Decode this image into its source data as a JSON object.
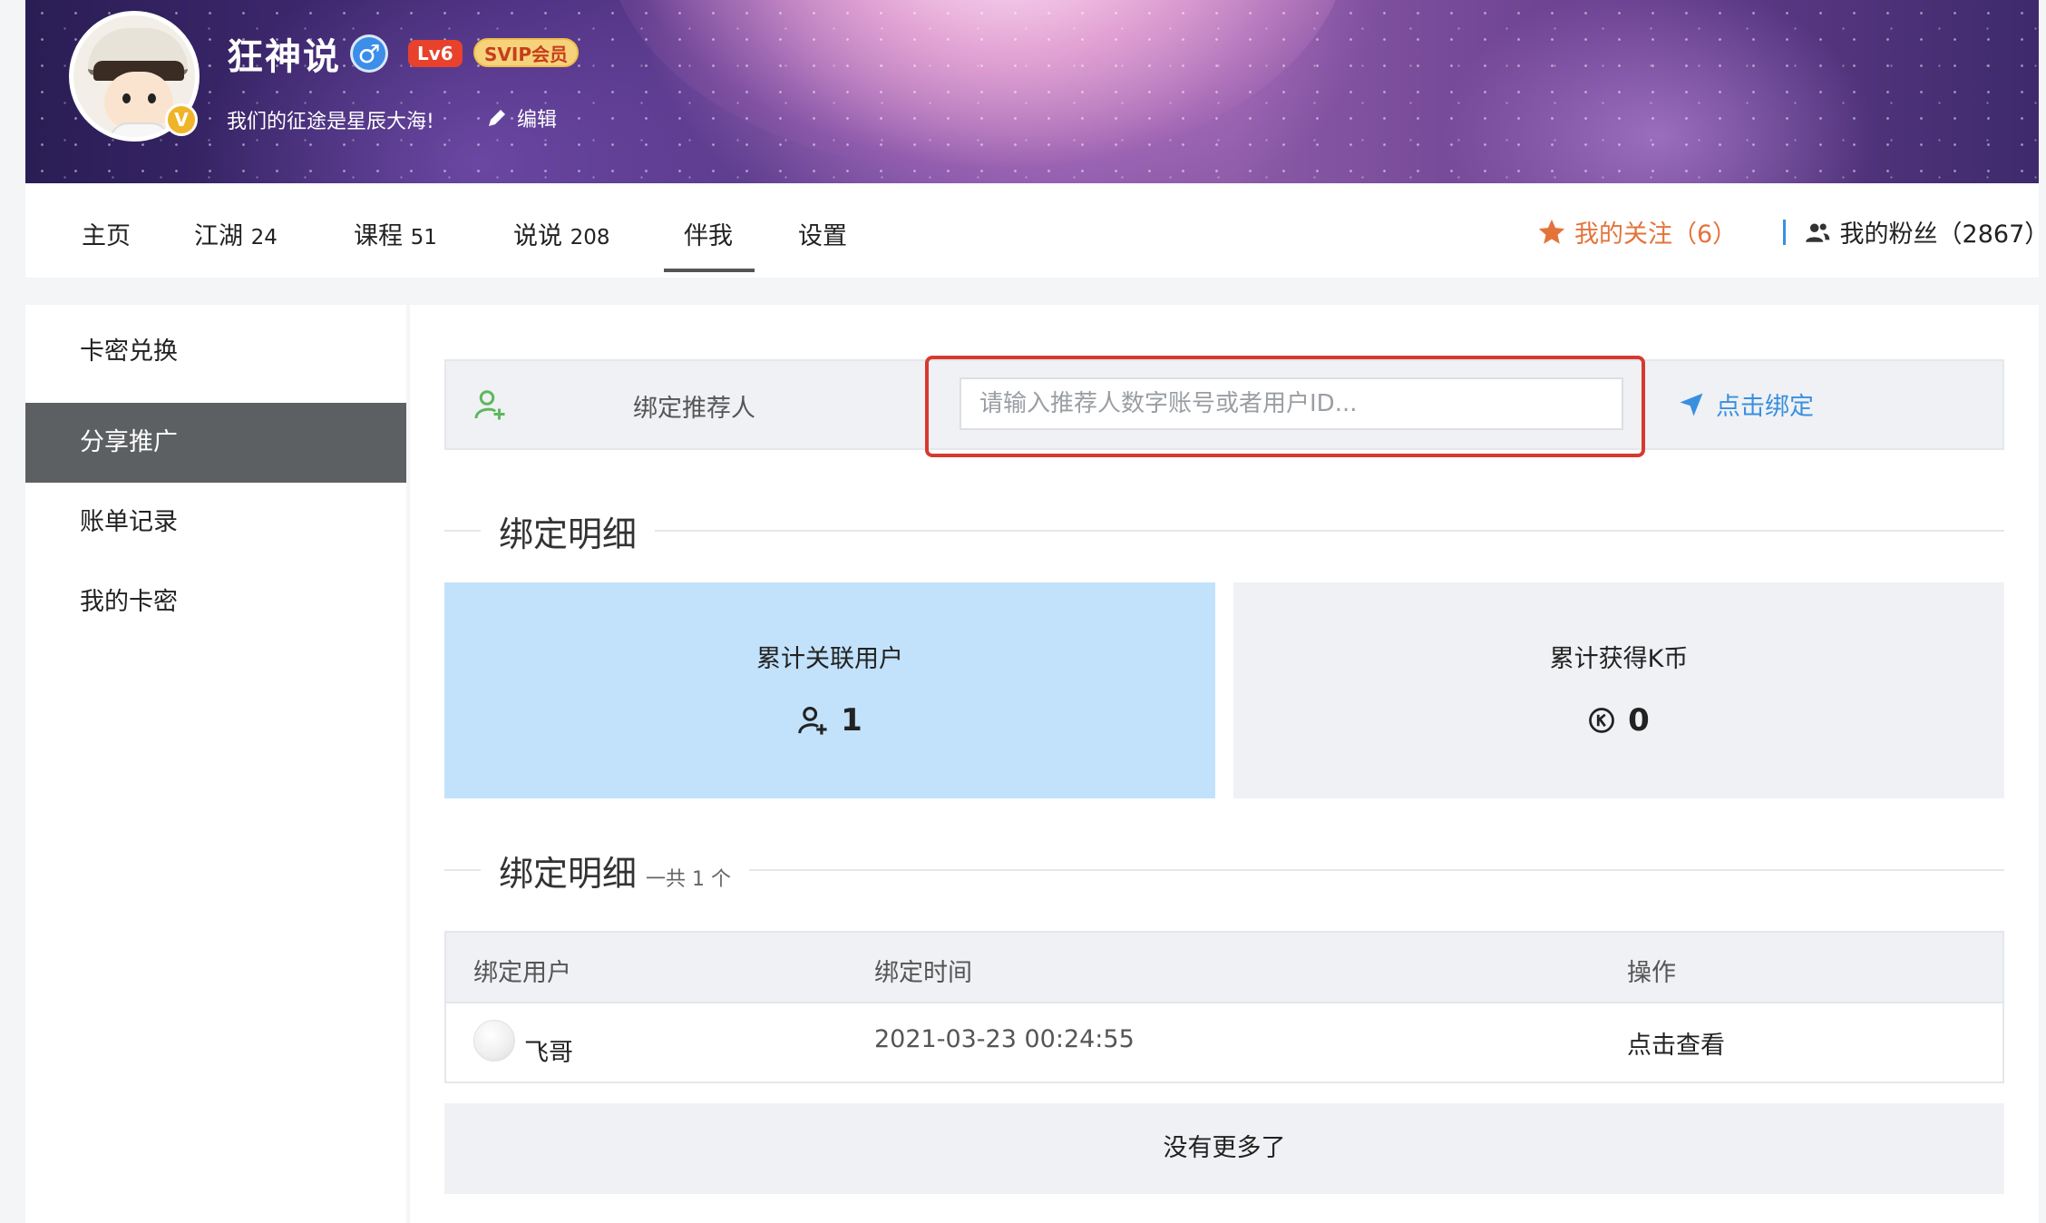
{
  "profile": {
    "name": "狂神说",
    "gender_icon": "♂",
    "level": "Lv6",
    "vip": "SVIP会员",
    "verified_badge": "V",
    "motto": "我们的征途是星辰大海!",
    "edit_label": "编辑"
  },
  "nav": {
    "tabs": [
      {
        "label": "主页",
        "count": ""
      },
      {
        "label": "江湖",
        "count": "24"
      },
      {
        "label": "课程",
        "count": "51"
      },
      {
        "label": "说说",
        "count": "208"
      },
      {
        "label": "伴我",
        "count": ""
      },
      {
        "label": "设置",
        "count": ""
      }
    ],
    "active_tab": "伴我",
    "follow_label": "我的关注（6）",
    "fans_label": "我的粉丝（2867）"
  },
  "sidebar": {
    "items": [
      {
        "label": "卡密兑换"
      },
      {
        "label": "分享推广"
      },
      {
        "label": "账单记录"
      },
      {
        "label": "我的卡密"
      }
    ],
    "active": "分享推广"
  },
  "bind": {
    "label": "绑定推荐人",
    "placeholder": "请输入推荐人数字账号或者用户ID...",
    "value": "",
    "button": "点击绑定"
  },
  "detail_section": {
    "title": "绑定明细"
  },
  "stats": {
    "users_label": "累计关联用户",
    "users_value": "1",
    "coins_label": "累计获得K币",
    "coins_value": "0"
  },
  "list_section": {
    "title": "绑定明细",
    "subtitle": "一共 1 个"
  },
  "table": {
    "headers": [
      "绑定用户",
      "绑定时间",
      "操作"
    ],
    "rows": [
      {
        "user": "飞哥",
        "time": "2021-03-23 00:24:55",
        "action": "点击查看"
      }
    ]
  },
  "footer": {
    "no_more": "没有更多了"
  },
  "colors": {
    "accent_blue": "#3a8fe0",
    "follow_orange": "#e4733a",
    "active_sidebar": "#5d6063",
    "highlight_box": "#d63a2e",
    "stat_blue": "#c2e2fb"
  }
}
